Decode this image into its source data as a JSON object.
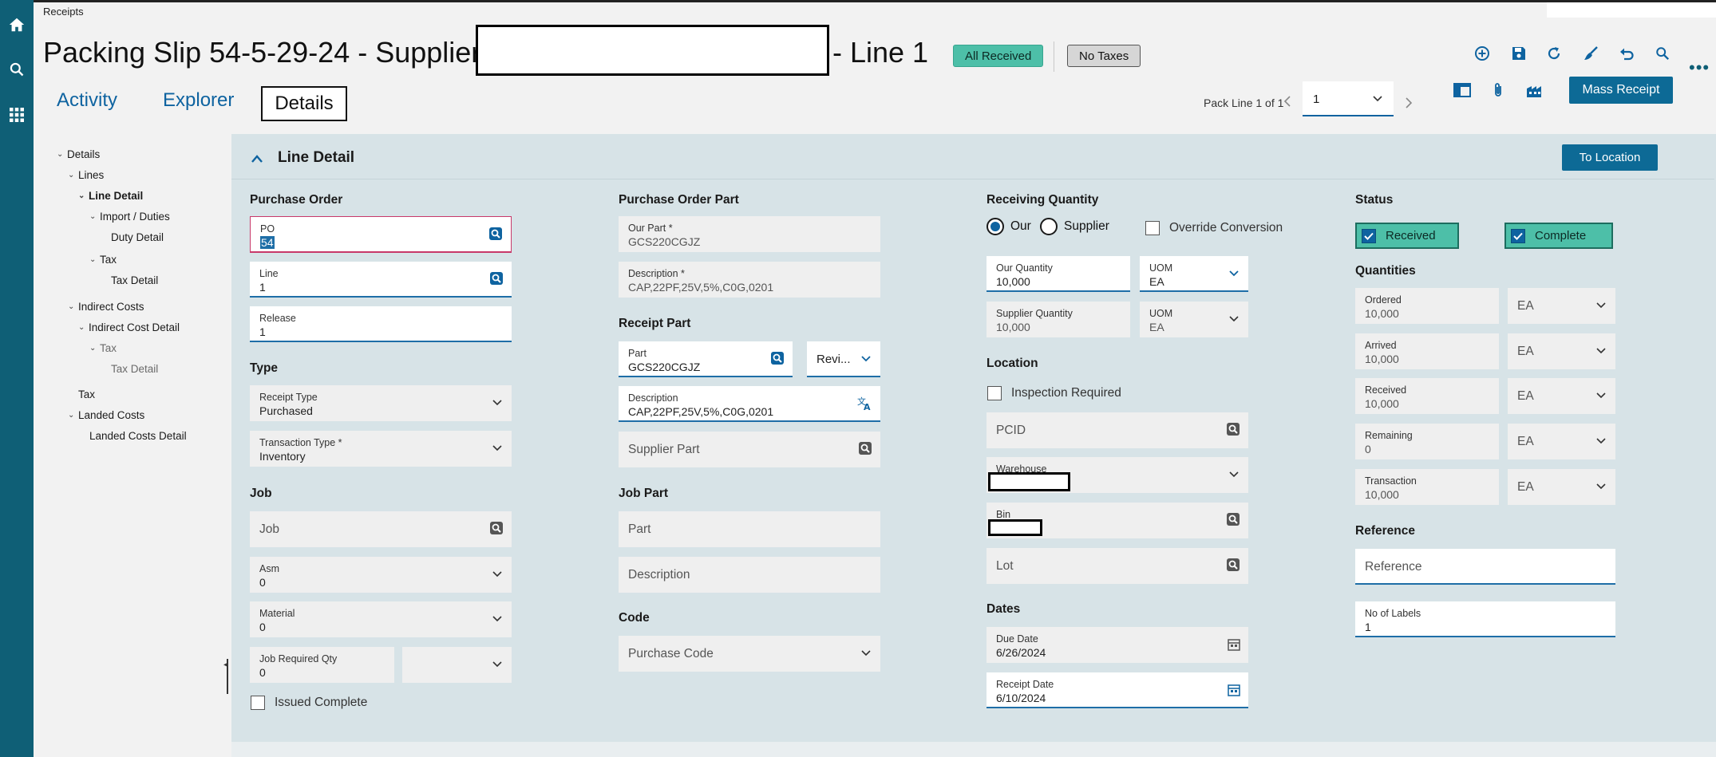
{
  "breadcrumb": "Receipts",
  "header": {
    "title_prefix": "Packing Slip 54-5-29-24 - Supplier",
    "title_suffix": "- Line 1",
    "badge_received": "All Received",
    "badge_taxes": "No Taxes",
    "mass_receipt": "Mass Receipt"
  },
  "tabs": [
    "Activity",
    "Explorer",
    "Details"
  ],
  "pager": {
    "label": "Pack Line 1 of 1",
    "value": "1"
  },
  "tree": {
    "items": [
      {
        "label": "Details"
      },
      {
        "label": "Lines"
      },
      {
        "label": "Line Detail"
      },
      {
        "label": "Import / Duties"
      },
      {
        "label": "Duty Detail"
      },
      {
        "label": "Tax"
      },
      {
        "label": "Tax Detail"
      },
      {
        "label": "Indirect Costs"
      },
      {
        "label": "Indirect Cost Detail"
      },
      {
        "label": "Tax"
      },
      {
        "label": "Tax Detail"
      },
      {
        "label": "Tax"
      },
      {
        "label": "Landed Costs"
      },
      {
        "label": "Landed Costs Detail"
      }
    ]
  },
  "panel": {
    "title": "Line Detail",
    "to_location": "To Location",
    "col1": {
      "purchase_order": "Purchase Order",
      "po": {
        "label": "PO",
        "value": "54"
      },
      "line": {
        "label": "Line",
        "value": "1"
      },
      "release": {
        "label": "Release",
        "value": "1"
      },
      "type": "Type",
      "receipt_type": {
        "label": "Receipt Type",
        "value": "Purchased"
      },
      "transaction_type": {
        "label": "Transaction Type *",
        "value": "Inventory"
      },
      "job": "Job",
      "job_field": {
        "placeholder": "Job"
      },
      "asm": {
        "label": "Asm",
        "value": "0"
      },
      "material": {
        "label": "Material",
        "value": "0"
      },
      "job_required_qty": {
        "label": "Job Required Qty",
        "value": "0"
      },
      "issued_complete": "Issued Complete"
    },
    "col2": {
      "purchase_order_part": "Purchase Order Part",
      "our_part": {
        "label": "Our Part *",
        "value": "GCS220CGJZ"
      },
      "description": {
        "label": "Description *",
        "value": "CAP,22PF,25V,5%,C0G,0201"
      },
      "receipt_part": "Receipt Part",
      "part": {
        "label": "Part",
        "value": "GCS220CGJZ"
      },
      "revision": "Revi...",
      "rp_description": {
        "label": "Description",
        "value": "CAP,22PF,25V,5%,C0G,0201"
      },
      "supplier_part": "Supplier Part",
      "job_part": "Job Part",
      "jp_part": "Part",
      "jp_description": "Description",
      "code": "Code",
      "purchase_code": "Purchase Code"
    },
    "col3": {
      "receiving_quantity": "Receiving Quantity",
      "radio_our": "Our",
      "radio_supplier": "Supplier",
      "override_conversion": "Override Conversion",
      "our_quantity": {
        "label": "Our Quantity",
        "value": "10,000"
      },
      "uom1": {
        "label": "UOM",
        "value": "EA"
      },
      "supplier_quantity": {
        "label": "Supplier Quantity",
        "value": "10,000"
      },
      "uom2": {
        "label": "UOM",
        "value": "EA"
      },
      "location": "Location",
      "inspection_required": "Inspection Required",
      "pcid": "PCID",
      "warehouse": "Warehouse",
      "bin": "Bin",
      "lot": "Lot",
      "dates": "Dates",
      "due_date": {
        "label": "Due Date",
        "value": "6/26/2024"
      },
      "receipt_date": {
        "label": "Receipt Date",
        "value": "6/10/2024"
      }
    },
    "col4": {
      "status": "Status",
      "received": "Received",
      "complete": "Complete",
      "quantities": "Quantities",
      "rows": [
        {
          "label": "Ordered",
          "value": "10,000",
          "uom": "EA"
        },
        {
          "label": "Arrived",
          "value": "10,000",
          "uom": "EA"
        },
        {
          "label": "Received",
          "value": "10,000",
          "uom": "EA"
        },
        {
          "label": "Remaining",
          "value": "0",
          "uom": "EA"
        },
        {
          "label": "Transaction",
          "value": "10,000",
          "uom": "EA"
        }
      ],
      "reference": "Reference",
      "reference_field": "Reference",
      "no_of_labels": {
        "label": "No of Labels",
        "value": "1"
      }
    }
  },
  "colors": {
    "rail": "#0f5f76",
    "accent": "#0d6a96",
    "badge_green": "#4dbfa8"
  }
}
